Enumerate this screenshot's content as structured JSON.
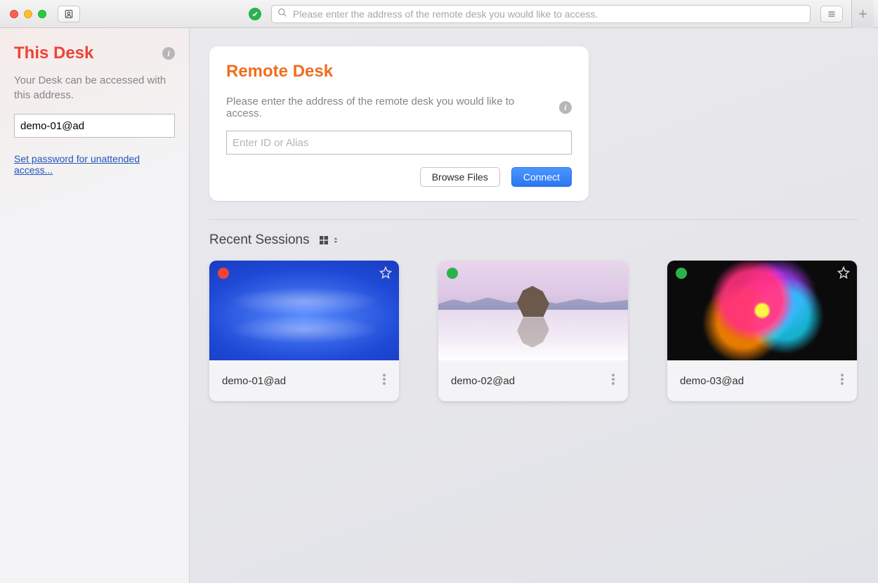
{
  "titlebar": {
    "search_placeholder": "Please enter the address of the remote desk you would like to access."
  },
  "sidebar": {
    "title": "This Desk",
    "description": "Your Desk can be accessed with this address.",
    "address_value": "demo-01@ad",
    "password_link": "Set password for unattended access..."
  },
  "remote": {
    "title": "Remote Desk",
    "description": "Please enter the address of the remote desk you would like to access.",
    "input_placeholder": "Enter ID or Alias",
    "browse_label": "Browse Files",
    "connect_label": "Connect"
  },
  "sessions": {
    "heading": "Recent Sessions",
    "items": [
      {
        "label": "demo-01@ad",
        "status_color": "#ee4338"
      },
      {
        "label": "demo-02@ad",
        "status_color": "#2bb24c"
      },
      {
        "label": "demo-03@ad",
        "status_color": "#2bb24c"
      }
    ]
  }
}
